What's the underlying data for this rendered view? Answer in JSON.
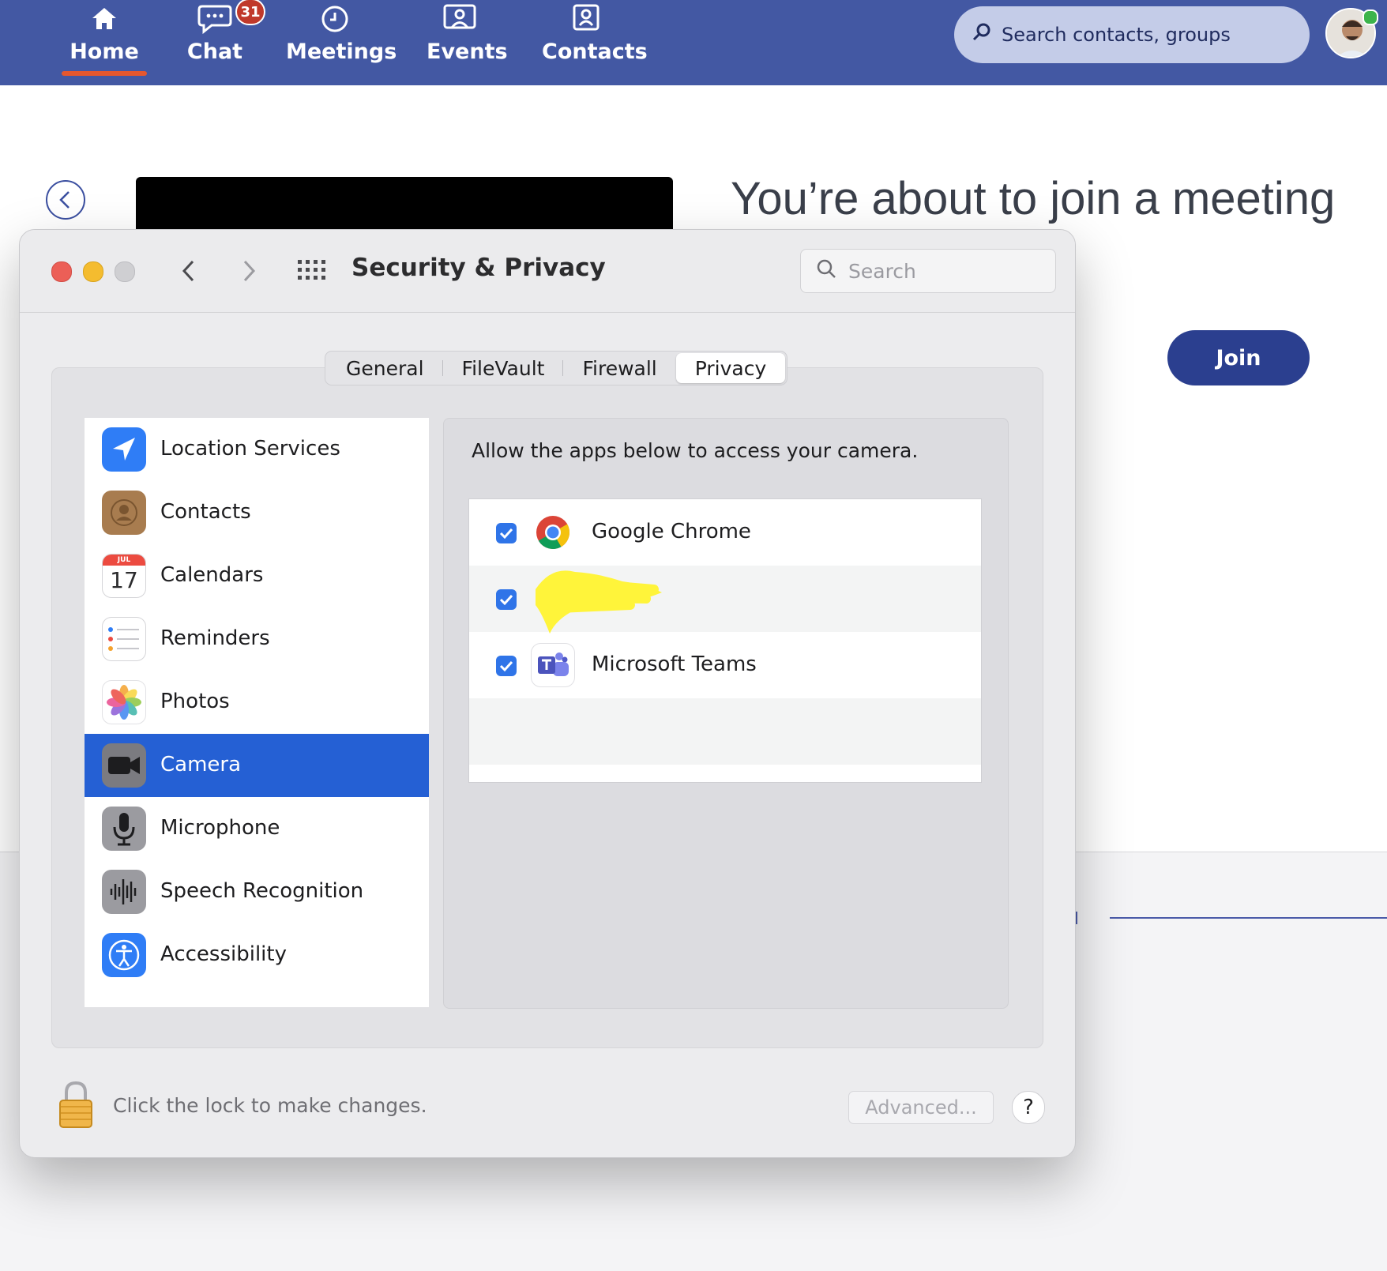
{
  "app": {
    "nav": [
      {
        "label": "Home",
        "icon": "home-icon",
        "active": true
      },
      {
        "label": "Chat",
        "icon": "chat-icon",
        "badge": "31"
      },
      {
        "label": "Meetings",
        "icon": "clock-icon"
      },
      {
        "label": "Events",
        "icon": "events-icon"
      },
      {
        "label": "Contacts",
        "icon": "contacts-icon"
      }
    ],
    "search_placeholder": "Search contacts, groups",
    "join_title": "You’re about to join a meeting",
    "join_button": "Join",
    "colors": {
      "topbar": "#4358a3",
      "accent": "#e4572e",
      "join": "#2b3f8f"
    }
  },
  "dialog": {
    "title": "Security & Privacy",
    "search_placeholder": "Search",
    "tabs": [
      {
        "label": "General"
      },
      {
        "label": "FileVault"
      },
      {
        "label": "Firewall"
      },
      {
        "label": "Privacy",
        "active": true
      }
    ],
    "sidebar": [
      {
        "label": "Location Services",
        "icon": "location-arrow-icon"
      },
      {
        "label": "Contacts",
        "icon": "contacts-book-icon"
      },
      {
        "label": "Calendars",
        "icon": "calendar-icon",
        "month": "JUL",
        "day": "17"
      },
      {
        "label": "Reminders",
        "icon": "reminders-icon"
      },
      {
        "label": "Photos",
        "icon": "photos-icon"
      },
      {
        "label": "Camera",
        "icon": "camera-icon",
        "selected": true
      },
      {
        "label": "Microphone",
        "icon": "microphone-icon"
      },
      {
        "label": "Speech Recognition",
        "icon": "waveform-icon"
      },
      {
        "label": "Accessibility",
        "icon": "accessibility-icon"
      }
    ],
    "allow_text": "Allow the apps below to access your camera.",
    "apps": [
      {
        "name": "Google Chrome",
        "checked": true,
        "icon": "chrome-icon"
      },
      {
        "name": "",
        "checked": true,
        "icon": "redacted-app-icon"
      },
      {
        "name": "Microsoft Teams",
        "checked": true,
        "icon": "teams-icon"
      }
    ],
    "lock_text": "Click the lock to make changes.",
    "advanced_button": "Advanced...",
    "help_button": "?",
    "colors": {
      "selection": "#2560d4",
      "checkbox": "#2f74e8"
    }
  }
}
